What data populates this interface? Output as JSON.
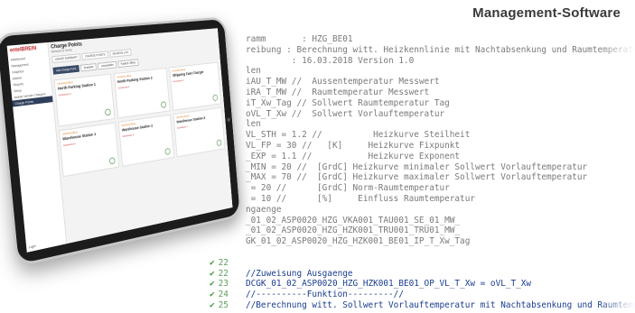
{
  "header": {
    "title": "Management-Software"
  },
  "code": {
    "lines": [
      {
        "num": "",
        "text": "ramm       : HZG_BE01"
      },
      {
        "num": "",
        "text": "reibung : Berechnung witt. Heizkennlinie mit Nachtabsenkung und Raumtemperatu"
      },
      {
        "num": "",
        "text": "         : 16.03.2018 Version 1.0"
      },
      {
        "num": "",
        "text": "len"
      },
      {
        "num": "",
        "text": "iAU_T_MW //  Aussentemperatur Messwert"
      },
      {
        "num": "",
        "text": "iRA_T_MW //  Raumtemperatur Messwert"
      },
      {
        "num": "",
        "text": "iT_Xw_Tag // Sollwert Raumtemperatur Tag"
      },
      {
        "num": "",
        "text": "oVL_T_Xw //  Sollwert Vorlauftemperatur"
      },
      {
        "num": "",
        "text": "len"
      },
      {
        "num": "",
        "text": "VL_STH = 1.2 //          Heizkurve Steilheit"
      },
      {
        "num": "",
        "text": "VL_FP = 30 //   [K]     Heizkurve Fixpunkt"
      },
      {
        "num": "",
        "text": "_EXP = 1.1 //           Heizkurve Exponent"
      },
      {
        "num": "",
        "text": "_MIN = 20 //  [GrdC] Heizkurve minimaler Sollwert Vorlauftemperatur"
      },
      {
        "num": "",
        "text": "_MAX = 70 //  [GrdC] Heizkurve maximaler Sollwert Vorlauftemperatur"
      },
      {
        "num": "",
        "text": " = 20 //      [GrdC] Norm-Raumtemperatur"
      },
      {
        "num": "",
        "text": " = 10 //      [%]     Einfluss Raumtemperatur"
      },
      {
        "num": "",
        "text": "ngaenge"
      },
      {
        "num": "",
        "text": "_01_02_ASP0020_HZG_VKA001_TAU001_SE_01_MW_"
      },
      {
        "num": "",
        "text": "_01_02_ASP0020_HZG_HZK001_TRU001_TRU01_MW_"
      },
      {
        "num": "",
        "text": "GK_01_02_ASP0020_HZG_HZK001_BE01_IP_T_Xw_Tag"
      },
      {
        "num": "",
        "text": ""
      },
      {
        "num": "22",
        "text": ""
      },
      {
        "num": "22",
        "text": "//Zuweisung Ausgaenge"
      },
      {
        "num": "23",
        "text": "DCGK_01_02_ASP0020_HZG_HZK001_BE01_OP_VL_T_Xw = oVL_T_Xw"
      },
      {
        "num": "24",
        "text": "//----------Funktion---------//"
      },
      {
        "num": "25",
        "text": "//Berechnung witt. Sollwert Vorlauftemperatur mit Nachtabsenkung und Raumtemperatu"
      }
    ]
  },
  "tablet": {
    "logo": "entelBREIN",
    "sidebar": [
      "Dashboard",
      "Management",
      "Graphics",
      "Alarms",
      "Reports",
      "Setup",
      "Mobile Vehicle Chargers",
      "Charge Points"
    ],
    "active_index": 7,
    "login": "Login",
    "page_title": "Charge Points",
    "page_sub": "Network to Home",
    "tabs": [
      "USAGE SUMMARY",
      "CHARGE POINTS",
      "SESSION LOG"
    ],
    "buttons": [
      "Add Charge Point",
      "Available",
      "Unavailable",
      "Faulted Offline"
    ],
    "cards": [
      {
        "status": "UNAVAILABLE",
        "name": "North Parking Station 1",
        "conn": "Connector 1"
      },
      {
        "status": "UNAVAILABLE",
        "name": "North Parking Station 2",
        "conn": "Connector 1"
      },
      {
        "status": "UNAVAILABLE",
        "name": "Shipping Fast Charger",
        "conn": "Connector 1"
      },
      {
        "status": "UNAVAILABLE",
        "name": "Warehouse Station 1",
        "conn": "Connector 1"
      },
      {
        "status": "UNAVAILABLE",
        "name": "Warehouse Station 2",
        "conn": "Connector 1"
      },
      {
        "status": "UNAVAILABLE",
        "name": "Warehouse Station 3",
        "conn": "Connector 1"
      }
    ]
  }
}
